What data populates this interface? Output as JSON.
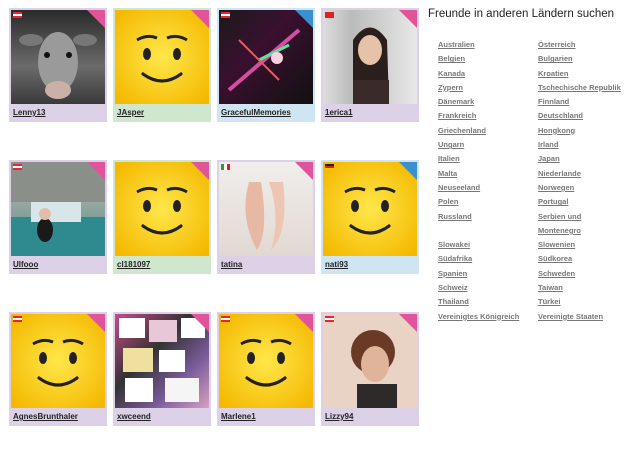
{
  "friends": [
    {
      "name": "Lenny13",
      "gender": "female",
      "flag": "at",
      "corner": "pink",
      "photo": "cow"
    },
    {
      "name": "JAsper",
      "gender": "neutral",
      "flag": "",
      "corner": "pink",
      "photo": "smiley"
    },
    {
      "name": "GracefulMemories",
      "gender": "male",
      "flag": "at",
      "corner": "blue",
      "photo": "plant"
    },
    {
      "name": "1erica1",
      "gender": "female",
      "flag": "tr",
      "corner": "pink",
      "photo": "girl1"
    },
    {
      "name": "Ulfooo",
      "gender": "female",
      "flag": "at",
      "corner": "pink",
      "photo": "water"
    },
    {
      "name": "cl181097",
      "gender": "neutral",
      "flag": "",
      "corner": "pink",
      "photo": "smiley"
    },
    {
      "name": "tatina",
      "gender": "female",
      "flag": "it",
      "corner": "pink",
      "photo": "shoes"
    },
    {
      "name": "nati93",
      "gender": "male",
      "flag": "de",
      "corner": "blue",
      "photo": "smiley"
    },
    {
      "name": "AgnesBrunthaler",
      "gender": "female",
      "flag": "at",
      "corner": "pink",
      "photo": "smiley"
    },
    {
      "name": "xwceend",
      "gender": "female",
      "flag": "",
      "corner": "pink",
      "photo": "collage"
    },
    {
      "name": "Marlene1",
      "gender": "female",
      "flag": "at",
      "corner": "pink",
      "photo": "smiley"
    },
    {
      "name": "Lizzy94",
      "gender": "female",
      "flag": "at",
      "corner": "pink",
      "photo": "girl2"
    }
  ],
  "sidebar": {
    "title": "Freunde in anderen Ländern suchen",
    "col_a": [
      "Australien",
      "Belgien",
      "Kanada",
      "Zypern",
      "Dänemark",
      "Frankreich",
      "Griechenland",
      "Ungarn",
      "Italien",
      "Malta",
      "Neuseeland",
      "Polen",
      "Russland",
      "",
      "Slowakei",
      "Südafrika",
      "Spanien",
      "Schweiz",
      "Thailand",
      "Vereinigtes Königreich"
    ],
    "col_b": [
      "Österreich",
      "Bulgarien",
      "Kroatien",
      "Tschechische Republik",
      "Finnland",
      "Deutschland",
      "Hongkong",
      "Irland",
      "Japan",
      "Niederlande",
      "Norwegen",
      "Portugal",
      "Serbien und",
      "Montenegro",
      "Slowenien",
      "Südkorea",
      "Schweden",
      "Taiwan",
      "Türkei",
      "Vereinigte Staaten"
    ]
  },
  "colors": {
    "female": "#dcd1e6",
    "male": "#cfe6f2",
    "neutral": "#cfe6cf",
    "corner_pink": "#e0559a",
    "corner_blue": "#3a8fcf"
  }
}
